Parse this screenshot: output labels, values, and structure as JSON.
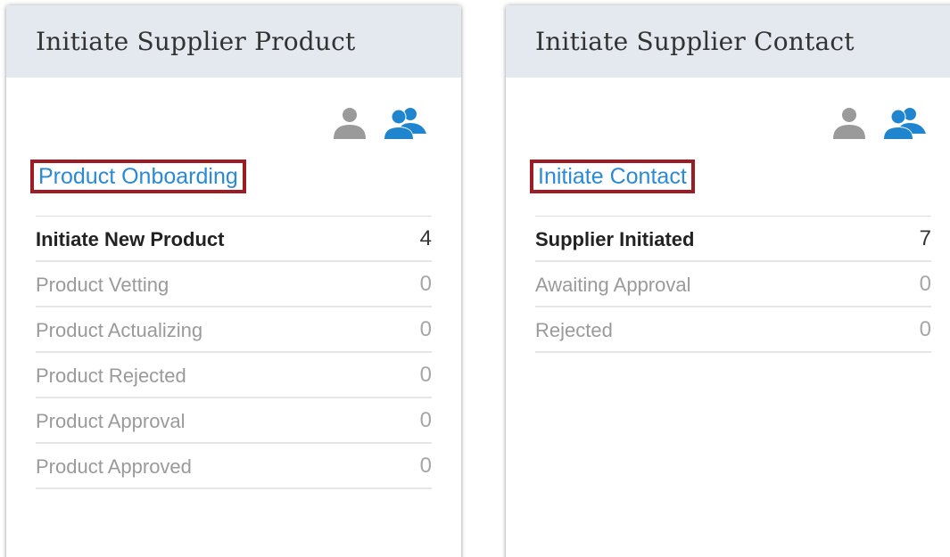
{
  "colors": {
    "header_bg": "#e3e9ee",
    "link": "#2a8ad4",
    "highlight_border": "#9e1b24",
    "icon_gray": "#9a9a9a",
    "icon_blue": "#1f85cf"
  },
  "cards": [
    {
      "title": "Initiate Supplier Product",
      "link": "Product Onboarding",
      "icons": [
        "single-user-icon",
        "group-users-icon"
      ],
      "rows": [
        {
          "label": "Initiate New Product",
          "count": "4",
          "active": true
        },
        {
          "label": "Product Vetting",
          "count": "0"
        },
        {
          "label": "Product Actualizing",
          "count": "0"
        },
        {
          "label": "Product Rejected",
          "count": "0"
        },
        {
          "label": "Product Approval",
          "count": "0"
        },
        {
          "label": "Product Approved",
          "count": "0"
        }
      ]
    },
    {
      "title": "Initiate Supplier Contact",
      "link": "Initiate Contact",
      "icons": [
        "single-user-icon",
        "group-users-icon"
      ],
      "rows": [
        {
          "label": "Supplier Initiated",
          "count": "7",
          "active": true
        },
        {
          "label": "Awaiting Approval",
          "count": "0"
        },
        {
          "label": "Rejected",
          "count": "0"
        }
      ]
    }
  ]
}
